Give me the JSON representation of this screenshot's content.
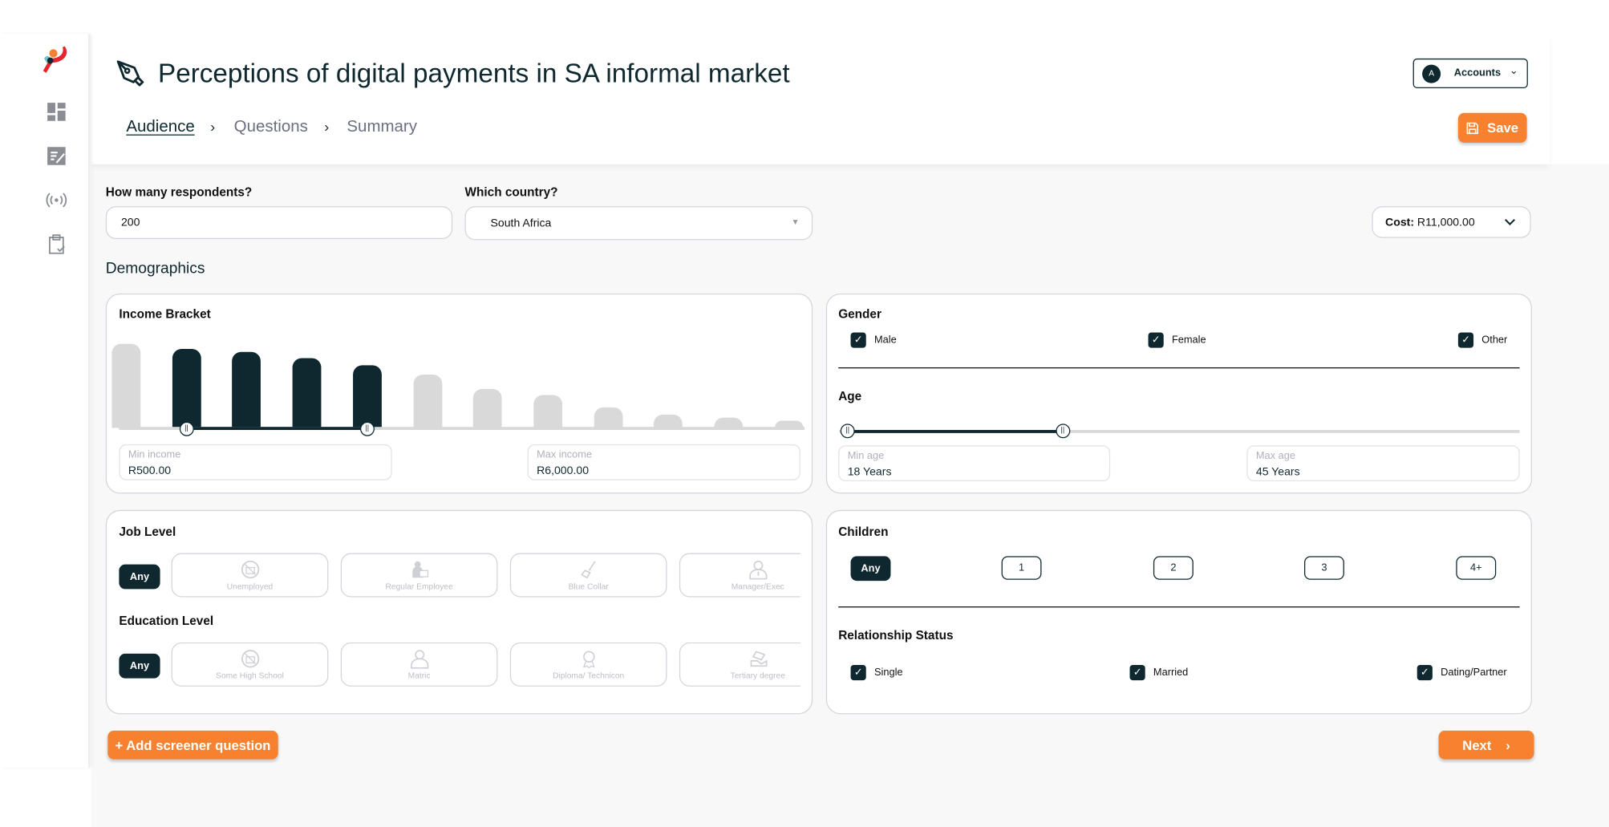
{
  "header": {
    "title": "Perceptions of digital payments in SA informal market",
    "breadcrumb": [
      "Audience",
      "Questions",
      "Summary"
    ],
    "account_initial": "A",
    "account_label": "Accounts",
    "save_label": "Save"
  },
  "sidebar": {
    "items": [
      "dashboard-icon",
      "surveys-icon",
      "broadcast-icon",
      "clipboard-icon"
    ]
  },
  "form": {
    "respondents_label": "How many respondents?",
    "respondents_value": "200",
    "country_label": "Which country?",
    "country_value": "South Africa",
    "cost_label": "Cost:",
    "cost_value": "R11,000.00"
  },
  "demographics_title": "Demographics",
  "income": {
    "title": "Income Bracket",
    "bars": [
      82,
      77,
      74,
      68,
      61,
      52,
      38,
      32,
      20,
      13,
      10,
      7
    ],
    "selected_range": [
      1,
      4
    ],
    "min_label": "Min income",
    "min_value": "R500.00",
    "max_label": "Max income",
    "max_value": "R6,000.00"
  },
  "gender": {
    "title": "Gender",
    "options": [
      {
        "label": "Male",
        "checked": true
      },
      {
        "label": "Female",
        "checked": true
      },
      {
        "label": "Other",
        "checked": true
      }
    ]
  },
  "age": {
    "title": "Age",
    "range_fraction": [
      0,
      0.32
    ],
    "min_label": "Min age",
    "min_value": "18 Years",
    "max_label": "Max age",
    "max_value": "45 Years"
  },
  "job": {
    "title": "Job Level",
    "any": "Any",
    "options": [
      "Unemployed",
      "Regular Employee",
      "Blue Collar",
      "Manager/Exec"
    ]
  },
  "education": {
    "title": "Education Level",
    "any": "Any",
    "options": [
      "Some High School",
      "Matric",
      "Diploma/ Technicon",
      "Tertiary degree"
    ]
  },
  "children": {
    "title": "Children",
    "options": [
      "Any",
      "1",
      "2",
      "3",
      "4+"
    ],
    "selected": "Any"
  },
  "relationship": {
    "title": "Relationship Status",
    "options": [
      {
        "label": "Single",
        "checked": true
      },
      {
        "label": "Married",
        "checked": true
      },
      {
        "label": "Dating/Partner",
        "checked": true
      }
    ]
  },
  "footer": {
    "add_label": "+ Add screener question",
    "next_label": "Next"
  },
  "colors": {
    "accent": "#f7812f",
    "dark": "#0f2830",
    "bar_inactive": "#d9d9d9"
  }
}
